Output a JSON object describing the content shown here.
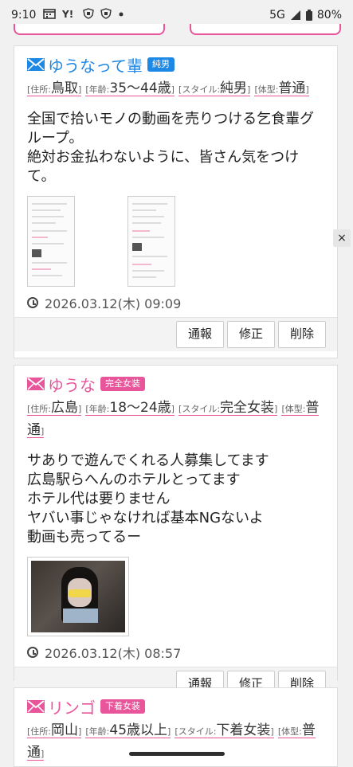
{
  "status_bar": {
    "time": "9:10",
    "network": "5G",
    "battery": "80%"
  },
  "colors": {
    "accent": "#e9559b",
    "name_blue": "#1e88e5",
    "name_pink": "#e9559b"
  },
  "posts": [
    {
      "name": "ゆうなって輩",
      "badge": "純男",
      "residence_label": "[住所:",
      "residence": "鳥取",
      "age_label": "[年齢:",
      "age": "35〜44歳",
      "style_label": "[スタイル:",
      "style": "純男",
      "body_label": "[体型:",
      "body_type": "普通",
      "text": "全国で拾いモノの動画を売りつける乞食輩グループ。\n絶対お金払わないように、皆さん気をつけて。",
      "date": "2026.03.12(木) 09:09"
    },
    {
      "name": "ゆうな",
      "badge": "完全女装",
      "residence_label": "[住所:",
      "residence": "広島",
      "age_label": "[年齢:",
      "age": "18〜24歳",
      "style_label": "[スタイル:",
      "style": "完全女装",
      "body_label": "[体型:",
      "body_type": "普通",
      "text": "サありで遊んでくれる人募集してます\n広島駅らへんのホテルとってます\nホテル代は要りません\nヤバい事じゃなければ基本NGないよ\n動画も売ってるー",
      "date": "2026.03.12(木) 08:57"
    },
    {
      "name": "リンゴ",
      "badge": "下着女装",
      "residence_label": "[住所:",
      "residence": "岡山",
      "age_label": "[年齢:",
      "age": "45歳以上",
      "style_label": "[スタイル:",
      "style": "下着女装",
      "body_label": "[体型:",
      "body_type": "普通"
    }
  ],
  "actions": {
    "report": "通報",
    "edit": "修正",
    "delete": "削除"
  },
  "close_button": "×"
}
